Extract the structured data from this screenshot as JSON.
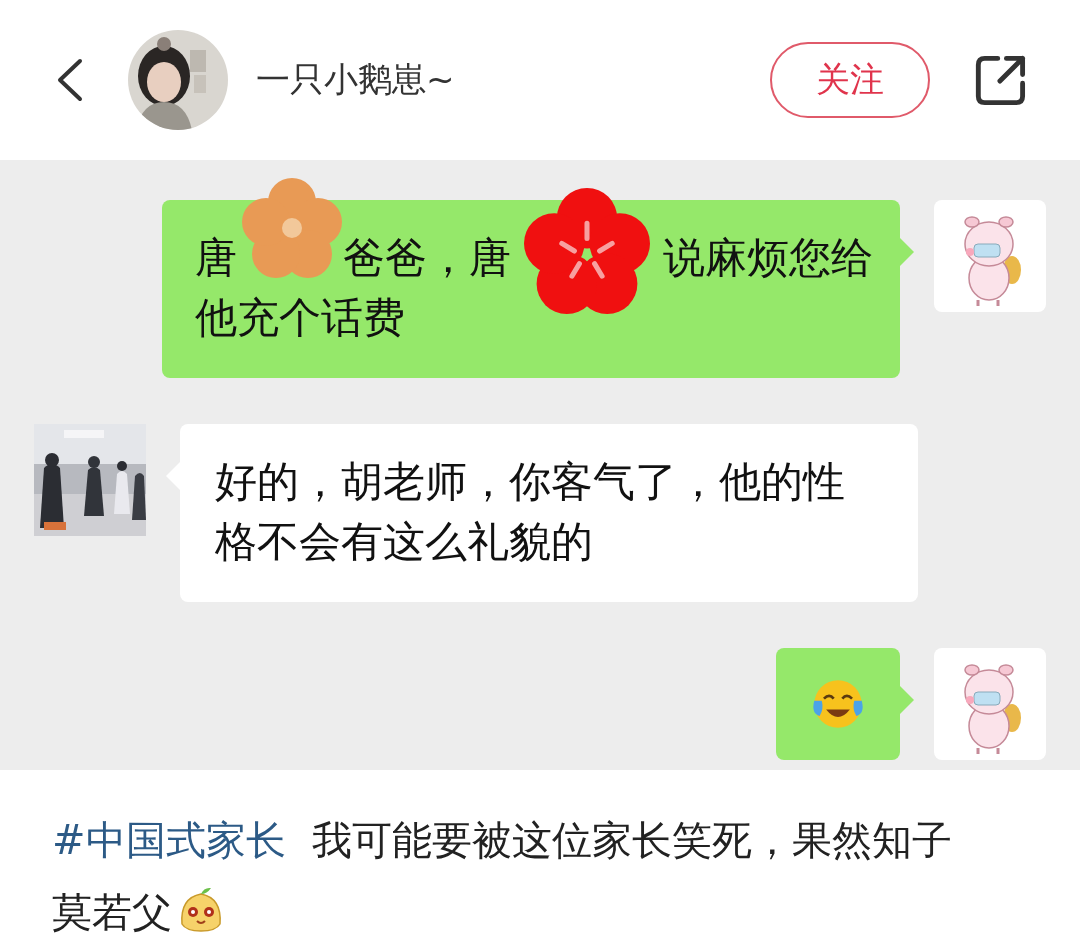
{
  "header": {
    "user_name": "一只小鹅崽~",
    "follow_button": "关注"
  },
  "chat": {
    "messages": [
      {
        "incoming": false,
        "kind": "covered_text",
        "lines": [
          [
            "唐",
            "爸爸，唐",
            "说麻烦您给"
          ],
          [
            "他充个话费"
          ]
        ]
      },
      {
        "incoming": true,
        "kind": "text",
        "text": "好的，胡老师，你客气了，他的性格不会有这么礼貌的"
      },
      {
        "incoming": false,
        "kind": "emoji"
      }
    ]
  },
  "caption": {
    "hashtag": "#中国式家长",
    "text": "我可能要被这位家长笑死，果然知子莫若父"
  }
}
